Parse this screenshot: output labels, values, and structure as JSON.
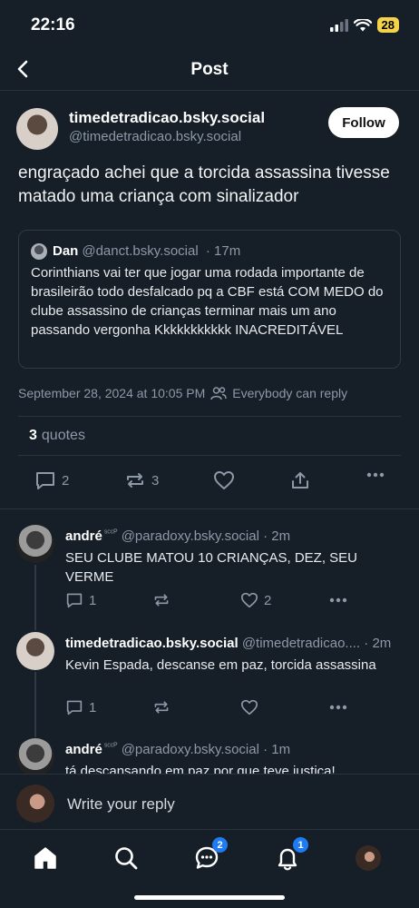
{
  "status": {
    "time": "22:16",
    "battery": "28"
  },
  "header": {
    "title": "Post"
  },
  "post": {
    "author_name": "timedetradicao.bsky.social",
    "author_handle": "@timedetradicao.bsky.social",
    "follow_label": "Follow",
    "text": "engraçado achei que a torcida assassina tivesse matado uma criança com sinalizador",
    "quote": {
      "name": "Dan",
      "handle": "@danct.bsky.social",
      "time": "· 17m",
      "text": "Corinthians vai ter que jogar uma rodada importante de brasileirão todo desfalcado pq a CBF está COM MEDO do clube assassino de crianças terminar mais um ano passando vergonha Kkkkkkkkkkk INACREDITÁVEL"
    },
    "timestamp": "September 28, 2024 at 10:05 PM",
    "reply_setting": "Everybody can reply",
    "quotes_count": "3",
    "quotes_label": "quotes",
    "reply_count": "2",
    "repost_count": "3"
  },
  "replies": [
    {
      "name": "andré",
      "name_suffix": "ˢᶜᶜᴾ",
      "handle": "@paradoxy.bsky.social",
      "time": "· 2m",
      "text": "SEU CLUBE MATOU 10 CRIANÇAS, DEZ, SEU VERME",
      "reply_count": "1",
      "like_count": "2"
    },
    {
      "name": "timedetradicao.bsky.social",
      "name_suffix": "",
      "handle": "@timedetradicao....",
      "time": "· 2m",
      "text": "Kevin Espada, descanse em paz, torcida assassina",
      "reply_count": "1",
      "like_count": ""
    },
    {
      "name": "andré",
      "name_suffix": "ˢᶜᶜᴾ",
      "handle": "@paradoxy.bsky.social",
      "time": "· 1m",
      "text": "tá descansando em paz por que teve justiça!",
      "reply_count": "",
      "like_count": ""
    }
  ],
  "compose": {
    "placeholder": "Write your reply"
  },
  "bottom_nav": {
    "chat_badge": "2",
    "notifications_badge": "1"
  },
  "colors": {
    "background": "#161e27",
    "accent": "#1f7bf2",
    "muted": "#8c99a8"
  }
}
